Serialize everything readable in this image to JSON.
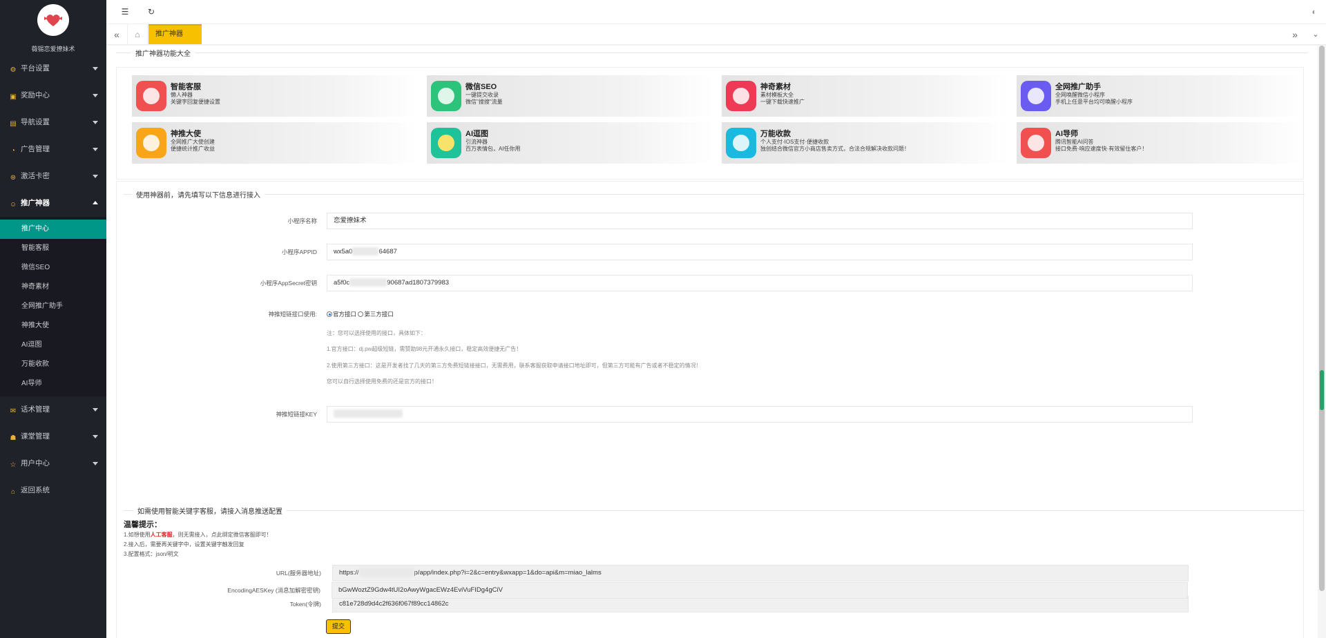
{
  "brand": {
    "name": "薇锡恋爱撩妹术"
  },
  "sidebar": {
    "items": [
      {
        "label": "平台设置",
        "icon": "gear-icon"
      },
      {
        "label": "奖励中心",
        "icon": "gift-icon"
      },
      {
        "label": "导航设置",
        "icon": "nav-icon"
      },
      {
        "label": "广告管理",
        "icon": "ad-icon"
      },
      {
        "label": "激活卡密",
        "icon": "key-icon"
      },
      {
        "label": "推广神器",
        "icon": "smile-icon"
      }
    ],
    "sub_items": [
      "推广中心",
      "智能客服",
      "微信SEO",
      "神奇素材",
      "全网推广助手",
      "神推大使",
      "AI逗图",
      "万能收款",
      "AI导师"
    ],
    "bottom_items": [
      {
        "label": "话术管理",
        "icon": "chat-icon"
      },
      {
        "label": "课堂管理",
        "icon": "class-icon"
      },
      {
        "label": "用户中心",
        "icon": "star-icon"
      },
      {
        "label": "返回系统",
        "icon": "home-icon"
      }
    ]
  },
  "tabs": {
    "active": "推广神器"
  },
  "features": {
    "legend": "推广神器功能大全",
    "items": [
      {
        "title": "智能客服",
        "line1": "懒人神器",
        "line2": "关键字回复便捷设置",
        "color": "#f0504f"
      },
      {
        "title": "微信SEO",
        "line1": "一键提交收录",
        "line2": "微信\"搜搜\"流量",
        "color": "#2cc47a"
      },
      {
        "title": "神奇素材",
        "line1": "素材模板大全",
        "line2": "一键下载快速推广",
        "color": "#ef3a55"
      },
      {
        "title": "全网推广助手",
        "line1": "全网唤醒微信小程序",
        "line2": "手机上任意平台均可唤醒小程序",
        "color": "#6a5cf0"
      },
      {
        "title": "神推大使",
        "line1": "全网推广大使创建",
        "line2": "便捷统计推广收益",
        "color": "#f8a51a"
      },
      {
        "title": "AI逗图",
        "line1": "引流神器",
        "line2": "百万表情包，AI任你用",
        "color": "#20c29a"
      },
      {
        "title": "万能收款",
        "line1": "个人支付·IOS支付·便捷收款",
        "line2": "独创结合微信官方小商店售卖方式，合法合规解决收款问题！",
        "color": "#19b9e0"
      },
      {
        "title": "AI导师",
        "line1": "腾讯智能AI问答",
        "line2": "接口免费·响应速度快·有效留住客户！",
        "color": "#f0504f"
      }
    ]
  },
  "form": {
    "legend": "使用神器前，请先填写以下信息进行接入",
    "name_label": "小程序名称",
    "name_value": "恋爱撩妹术",
    "appid_label": "小程序APPID",
    "appid_prefix": "wx5a0",
    "appid_suffix": "64687",
    "secret_label": "小程序AppSecret密钥",
    "secret_prefix": "a5f0c",
    "secret_suffix": "90687ad1807379983",
    "api_label": "神推短链接口使用:",
    "radio_official": "官方接口",
    "radio_third": "第三方接口",
    "note0": "注：您可以选择使用的接口，具体如下：",
    "note1": "1.官方接口：dj.pw超级短链，需赞助98元开通永久接口，稳定高效便捷无广告！",
    "note2": "2.使用第三方接口：这是开发者找了几天的第三方免费短链接接口，无需费用，联系客服获取申请接口地址即可，但第三方可能有广告或者不稳定的情况！",
    "note3": "您可以自行选择使用免费的还是官方的接口！",
    "key_label": "神推短链接KEY"
  },
  "wechat": {
    "legend": "如需使用智能关键字客服，请接入消息推送配置",
    "tips_title": "温馨提示：",
    "tip1_a": "1.如想使用",
    "tip1_red": "人工客服",
    "tip1_b": "，则无需接入，点此绑定微信客服即可！",
    "tip2": "2.接入后，需要再关键字中，设置关键字触发回复",
    "tip3": "3.配置格式：json/明文",
    "url_label": "URL(服务器地址)",
    "url_prefix": "https://",
    "url_suffix": "p/app/index.php?i=2&c=entry&wxapp=1&do=api&m=miao_lalms",
    "token_label": "Token(令牌)",
    "token_value": "c81e728d9d4c2f636f067f89cc14862c",
    "aes_label": "EncodingAESKey (消息加解密密钥)",
    "aes_value": "bGwWoztZ9Gdw4tUI2oAwyWgacEWz4EviVuFIDg4gCiV",
    "submit": "提交"
  },
  "colors": {
    "accent": "#f7c000",
    "sidebar_bg": "#20222a",
    "active_sub": "#009688"
  }
}
